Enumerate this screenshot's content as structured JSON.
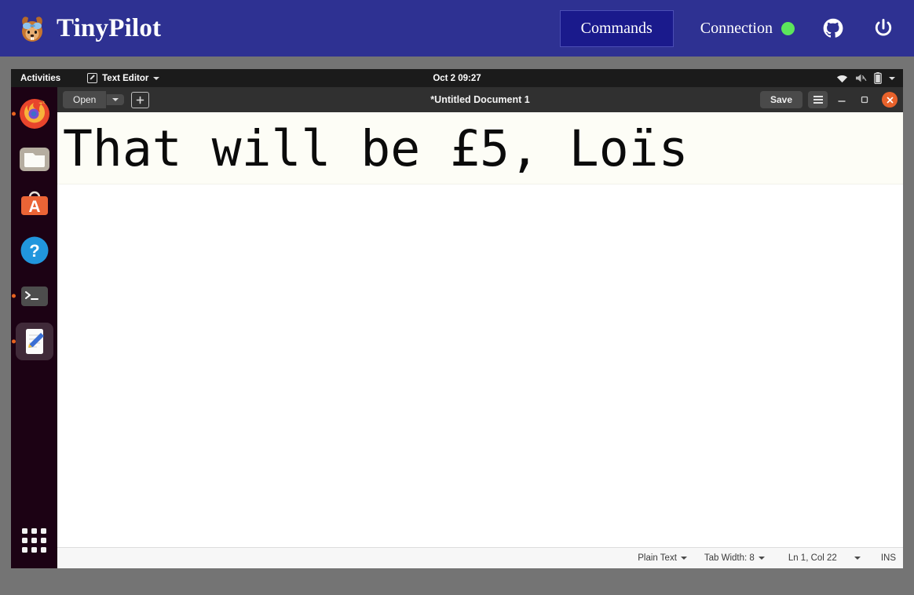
{
  "header": {
    "brand": "TinyPilot",
    "mascot_icon": "squirrel-mascot-icon",
    "commands_label": "Commands",
    "connection_label": "Connection",
    "connection_status_color": "#5ce65c",
    "github_icon": "github-icon",
    "power_icon": "power-icon",
    "background_color": "#2e3192",
    "commands_button_color": "#1a1a8c"
  },
  "desktop": {
    "topbar": {
      "activities_label": "Activities",
      "app_icon": "text-editor-icon",
      "app_name": "Text Editor",
      "app_caret_icon": "chevron-down-icon",
      "clock": "Oct 2  09:27",
      "tray": {
        "wifi_icon": "wifi-icon",
        "volume_icon": "volume-muted-icon",
        "battery_icon": "battery-icon",
        "caret_icon": "chevron-down-icon"
      }
    },
    "dock": {
      "items": [
        {
          "name": "firefox",
          "icon": "firefox-icon",
          "running": true,
          "active": false
        },
        {
          "name": "files",
          "icon": "files-folder-icon",
          "running": false,
          "active": false
        },
        {
          "name": "ubuntu-software",
          "icon": "ubuntu-software-icon",
          "running": false,
          "active": false
        },
        {
          "name": "help",
          "icon": "help-question-icon",
          "running": false,
          "active": false
        },
        {
          "name": "terminal",
          "icon": "terminal-icon",
          "running": true,
          "active": false
        },
        {
          "name": "text-editor",
          "icon": "text-editor-pencil-icon",
          "running": true,
          "active": true
        }
      ],
      "show_applications_icon": "app-grid-icon"
    },
    "editor": {
      "open_label": "Open",
      "open_caret_icon": "chevron-down-icon",
      "new_document_icon": "new-document-icon",
      "title": "*Untitled Document 1",
      "save_label": "Save",
      "menu_icon": "hamburger-menu-icon",
      "minimize_icon": "minimize-icon",
      "maximize_icon": "maximize-icon",
      "close_icon": "close-icon",
      "document_text": "That will be £5, Loïs",
      "statusbar": {
        "language": "Plain Text",
        "language_caret_icon": "chevron-down-icon",
        "tab_width": "Tab Width: 8",
        "tab_width_caret_icon": "chevron-down-icon",
        "cursor_position": "Ln 1, Col 22",
        "position_caret_icon": "chevron-down-icon",
        "insert_mode": "INS"
      }
    }
  }
}
